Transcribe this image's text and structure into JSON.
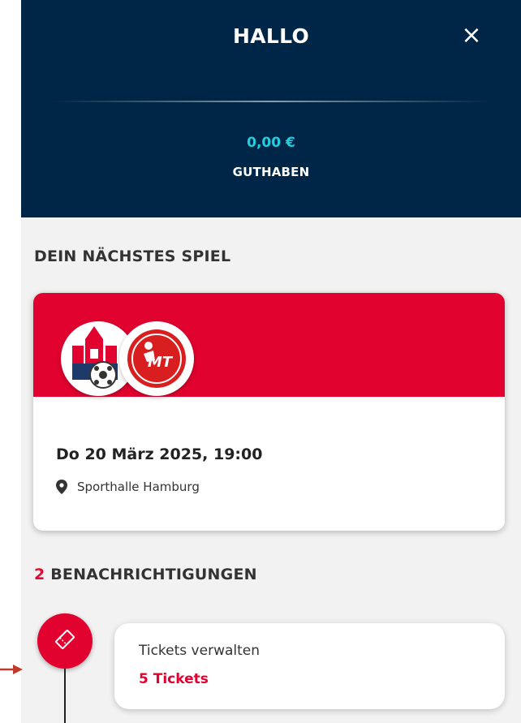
{
  "header": {
    "greeting": "HALLO",
    "close_symbol": "×",
    "balance": "0,00 €",
    "balance_label": "GUTHABEN"
  },
  "next_game": {
    "section_title": "DEIN NÄCHSTES SPIEL",
    "date_time": "Do 20 März 2025, 19:00",
    "venue": "Sporthalle Hamburg",
    "venue_icon": "map-pin-icon",
    "home_logo": "home-team-logo",
    "away_logo": "away-team-logo"
  },
  "notifications": {
    "count": "2",
    "label": " BENACHRICHTIGUNGEN",
    "items": [
      {
        "title": "Tickets verwalten",
        "subtitle": "5 Tickets",
        "icon": "ticket-icon"
      }
    ]
  },
  "colors": {
    "header_bg": "#002647",
    "accent_red": "#e2022f",
    "balance_cyan": "#22cfe0",
    "panel_bg": "#f2f2f2"
  }
}
